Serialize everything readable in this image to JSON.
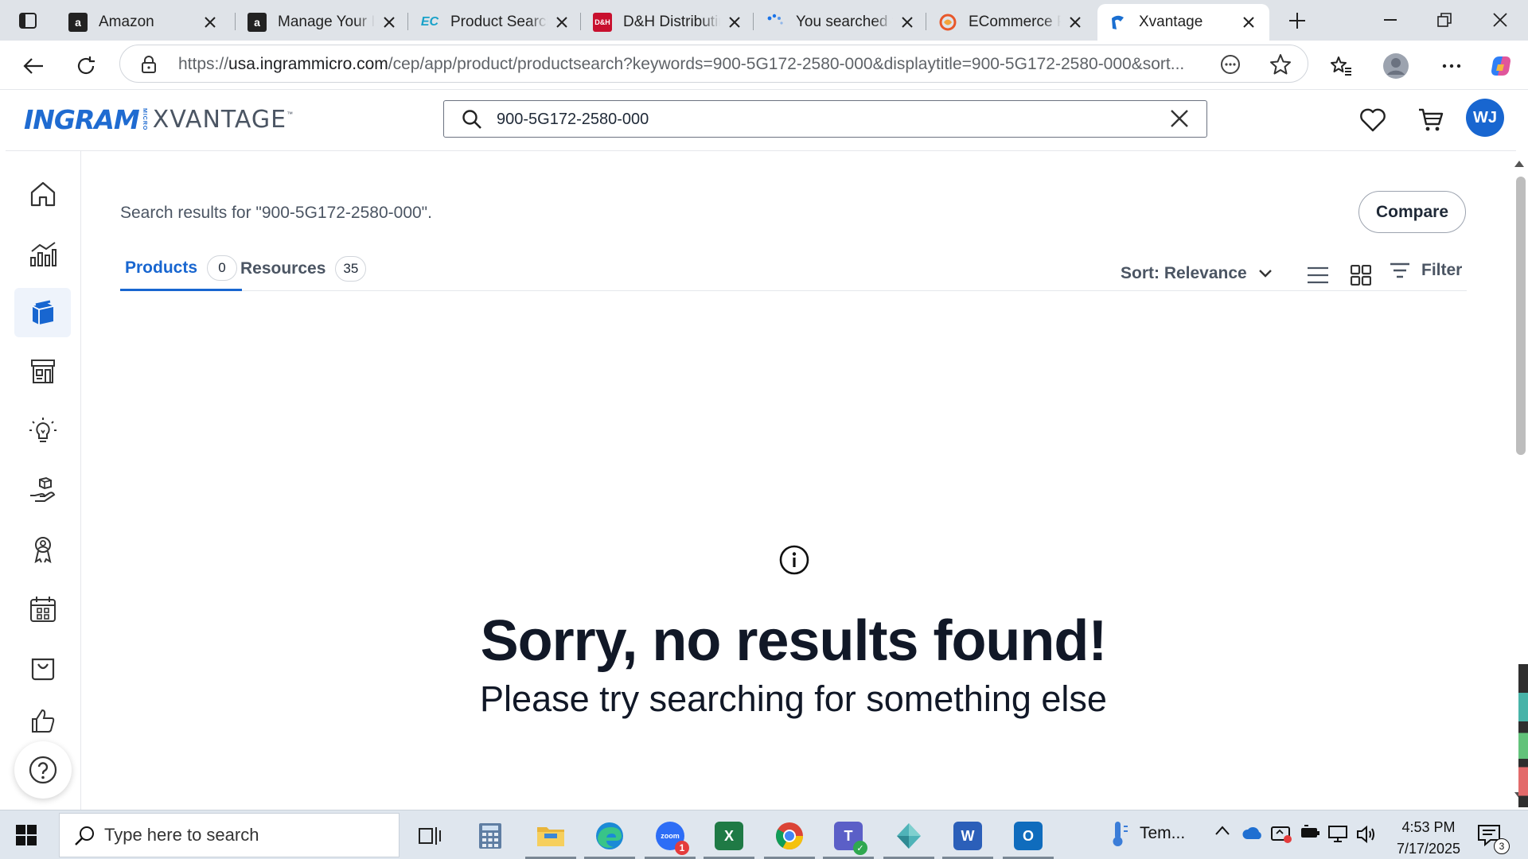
{
  "browser": {
    "tabs": [
      {
        "title": "Amazon",
        "favicon": "amazon-icon",
        "active": false
      },
      {
        "title": "Manage Your Inventory",
        "favicon": "amazon-icon",
        "active": false
      },
      {
        "title": "Product Search",
        "favicon": "ec-icon",
        "active": false
      },
      {
        "title": "D&H Distributing",
        "favicon": "dh-icon",
        "active": false
      },
      {
        "title": "You searched for",
        "favicon": "loading-icon",
        "active": false
      },
      {
        "title": "ECommerce Pro",
        "favicon": "ecommerce-icon",
        "active": false
      },
      {
        "title": "Xvantage",
        "favicon": "xvantage-icon",
        "active": true
      }
    ],
    "url_prefix": "https://",
    "url_host": "usa.ingrammicro.com",
    "url_path": "/cep/app/product/productsearch?keywords=900-5G172-2580-000&displaytitle=900-5G172-2580-000&sort..."
  },
  "header": {
    "logo_ingram": "INGRAM",
    "logo_micro": "MICRO",
    "logo_xvantage": "XVANTAGE",
    "logo_tm": "™",
    "search_value": "900-5G172-2580-000",
    "avatar_initials": "WJ"
  },
  "main": {
    "results_text": "Search results for \"900-5G172-2580-000\".",
    "compare_label": "Compare",
    "tabs": [
      {
        "label": "Products",
        "count": "0",
        "active": true
      },
      {
        "label": "Resources",
        "count": "35",
        "active": false
      }
    ],
    "sort_label": "Sort: Relevance",
    "filter_label": "Filter",
    "empty_title": "Sorry, no results found!",
    "empty_subtitle": "Please try searching for something else"
  },
  "taskbar": {
    "search_placeholder": "Type here to search",
    "weather_label": "Tem...",
    "time": "4:53 PM",
    "date": "7/17/2025",
    "notification_count": "3",
    "zoom_badge": "1"
  },
  "colors": {
    "brand_blue": "#1866d0",
    "active_nav_bg": "#eef3fb",
    "tabstrip_bg": "#dfe3e8",
    "taskbar_bg": "#dfe6ee"
  }
}
